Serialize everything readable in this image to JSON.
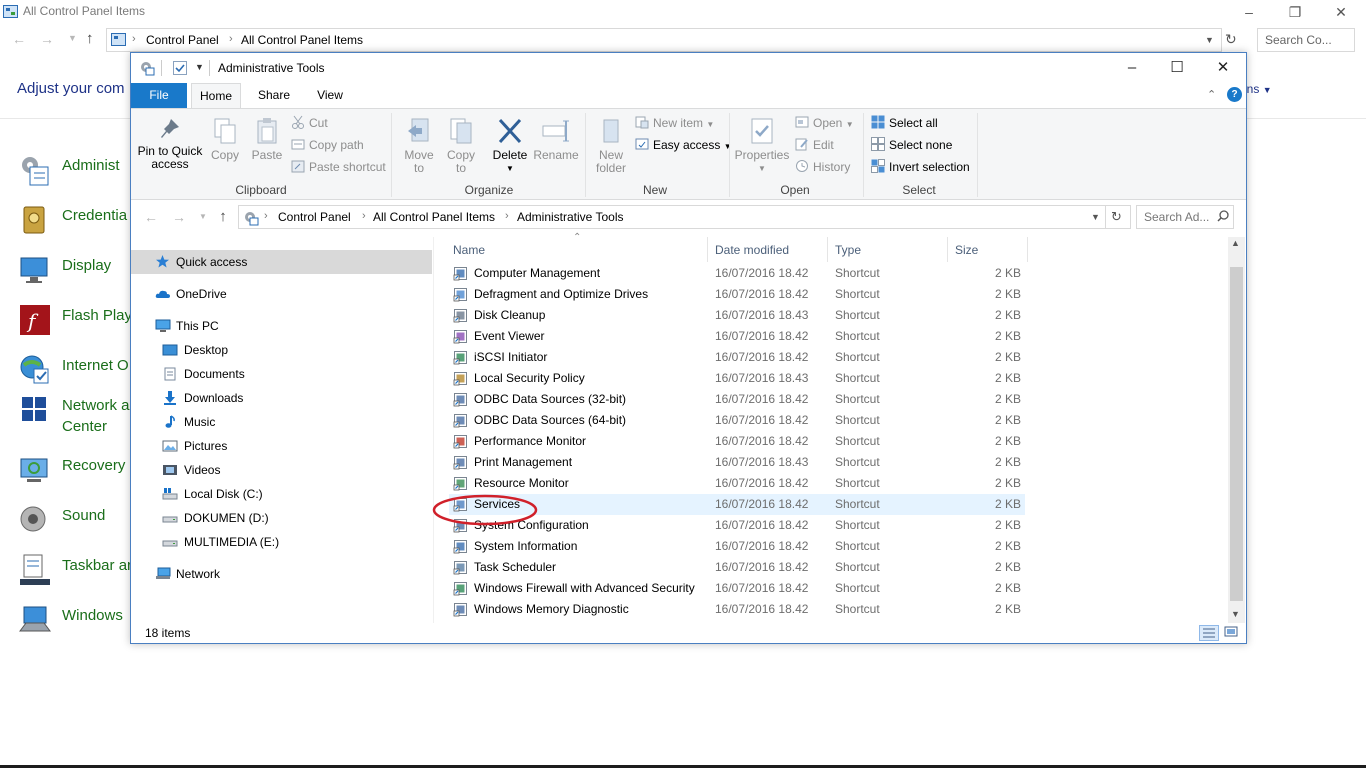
{
  "background": {
    "window_title": "All Control Panel Items",
    "breadcrumb": [
      "Control Panel",
      "All Control Panel Items"
    ],
    "search_placeholder": "Search Co...",
    "heading": "Adjust your com",
    "view_by_tail": "ons",
    "items": [
      {
        "label": "Administ",
        "icon": "admin-tools-icon"
      },
      {
        "label": "Credentia",
        "icon": "credential-manager-icon"
      },
      {
        "label": "Display",
        "icon": "display-icon"
      },
      {
        "label": "Flash Play",
        "icon": "flash-player-icon"
      },
      {
        "label": "Internet O",
        "icon": "internet-options-icon"
      },
      {
        "label": "Network a\nCenter",
        "icon": "network-center-icon"
      },
      {
        "label": "Recovery",
        "icon": "recovery-icon"
      },
      {
        "label": "Sound",
        "icon": "sound-icon"
      },
      {
        "label": "Taskbar ar",
        "icon": "taskbar-icon"
      },
      {
        "label": "Windows",
        "icon": "windows-mobility-icon"
      }
    ]
  },
  "explorer": {
    "title": "Administrative Tools",
    "tabs": {
      "file": "File",
      "home": "Home",
      "share": "Share",
      "view": "View"
    },
    "ribbon": {
      "clipboard": {
        "label": "Clipboard",
        "pin": "Pin to Quick\naccess",
        "copy": "Copy",
        "paste": "Paste",
        "cut": "Cut",
        "copy_path": "Copy path",
        "paste_shortcut": "Paste shortcut"
      },
      "organize": {
        "label": "Organize",
        "move_to": "Move\nto",
        "copy_to": "Copy\nto",
        "delete": "Delete",
        "rename": "Rename"
      },
      "new": {
        "label": "New",
        "new_folder": "New\nfolder",
        "new_item": "New item",
        "easy_access": "Easy access"
      },
      "open": {
        "label": "Open",
        "properties": "Properties",
        "open": "Open",
        "edit": "Edit",
        "history": "History"
      },
      "select": {
        "label": "Select",
        "select_all": "Select all",
        "select_none": "Select none",
        "invert": "Invert selection"
      }
    },
    "address": [
      "Control Panel",
      "All Control Panel Items",
      "Administrative Tools"
    ],
    "search_placeholder": "Search Ad...",
    "nav": {
      "quick_access": "Quick access",
      "onedrive": "OneDrive",
      "this_pc": "This PC",
      "desktop": "Desktop",
      "documents": "Documents",
      "downloads": "Downloads",
      "music": "Music",
      "pictures": "Pictures",
      "videos": "Videos",
      "local_disk": "Local Disk (C:)",
      "dokumen": "DOKUMEN (D:)",
      "multimedia": "MULTIMEDIA (E:)",
      "network": "Network"
    },
    "columns": {
      "name": "Name",
      "date": "Date modified",
      "type": "Type",
      "size": "Size"
    },
    "files": [
      {
        "name": "Computer Management",
        "date": "16/07/2016 18.42",
        "type": "Shortcut",
        "size": "2 KB"
      },
      {
        "name": "Defragment and Optimize Drives",
        "date": "16/07/2016 18.42",
        "type": "Shortcut",
        "size": "2 KB"
      },
      {
        "name": "Disk Cleanup",
        "date": "16/07/2016 18.43",
        "type": "Shortcut",
        "size": "2 KB"
      },
      {
        "name": "Event Viewer",
        "date": "16/07/2016 18.42",
        "type": "Shortcut",
        "size": "2 KB"
      },
      {
        "name": "iSCSI Initiator",
        "date": "16/07/2016 18.42",
        "type": "Shortcut",
        "size": "2 KB"
      },
      {
        "name": "Local Security Policy",
        "date": "16/07/2016 18.43",
        "type": "Shortcut",
        "size": "2 KB"
      },
      {
        "name": "ODBC Data Sources (32-bit)",
        "date": "16/07/2016 18.42",
        "type": "Shortcut",
        "size": "2 KB"
      },
      {
        "name": "ODBC Data Sources (64-bit)",
        "date": "16/07/2016 18.42",
        "type": "Shortcut",
        "size": "2 KB"
      },
      {
        "name": "Performance Monitor",
        "date": "16/07/2016 18.42",
        "type": "Shortcut",
        "size": "2 KB"
      },
      {
        "name": "Print Management",
        "date": "16/07/2016 18.43",
        "type": "Shortcut",
        "size": "2 KB"
      },
      {
        "name": "Resource Monitor",
        "date": "16/07/2016 18.42",
        "type": "Shortcut",
        "size": "2 KB"
      },
      {
        "name": "Services",
        "date": "16/07/2016 18.42",
        "type": "Shortcut",
        "size": "2 KB"
      },
      {
        "name": "System Configuration",
        "date": "16/07/2016 18.42",
        "type": "Shortcut",
        "size": "2 KB"
      },
      {
        "name": "System Information",
        "date": "16/07/2016 18.42",
        "type": "Shortcut",
        "size": "2 KB"
      },
      {
        "name": "Task Scheduler",
        "date": "16/07/2016 18.42",
        "type": "Shortcut",
        "size": "2 KB"
      },
      {
        "name": "Windows Firewall with Advanced Security",
        "date": "16/07/2016 18.42",
        "type": "Shortcut",
        "size": "2 KB"
      },
      {
        "name": "Windows Memory Diagnostic",
        "date": "16/07/2016 18.42",
        "type": "Shortcut",
        "size": "2 KB"
      }
    ],
    "selected_file": "Services",
    "status": "18 items",
    "colors": {
      "accent": "#1979ca",
      "highlight_ring": "#d0202a",
      "selected_row": "#e5f3ff"
    }
  }
}
